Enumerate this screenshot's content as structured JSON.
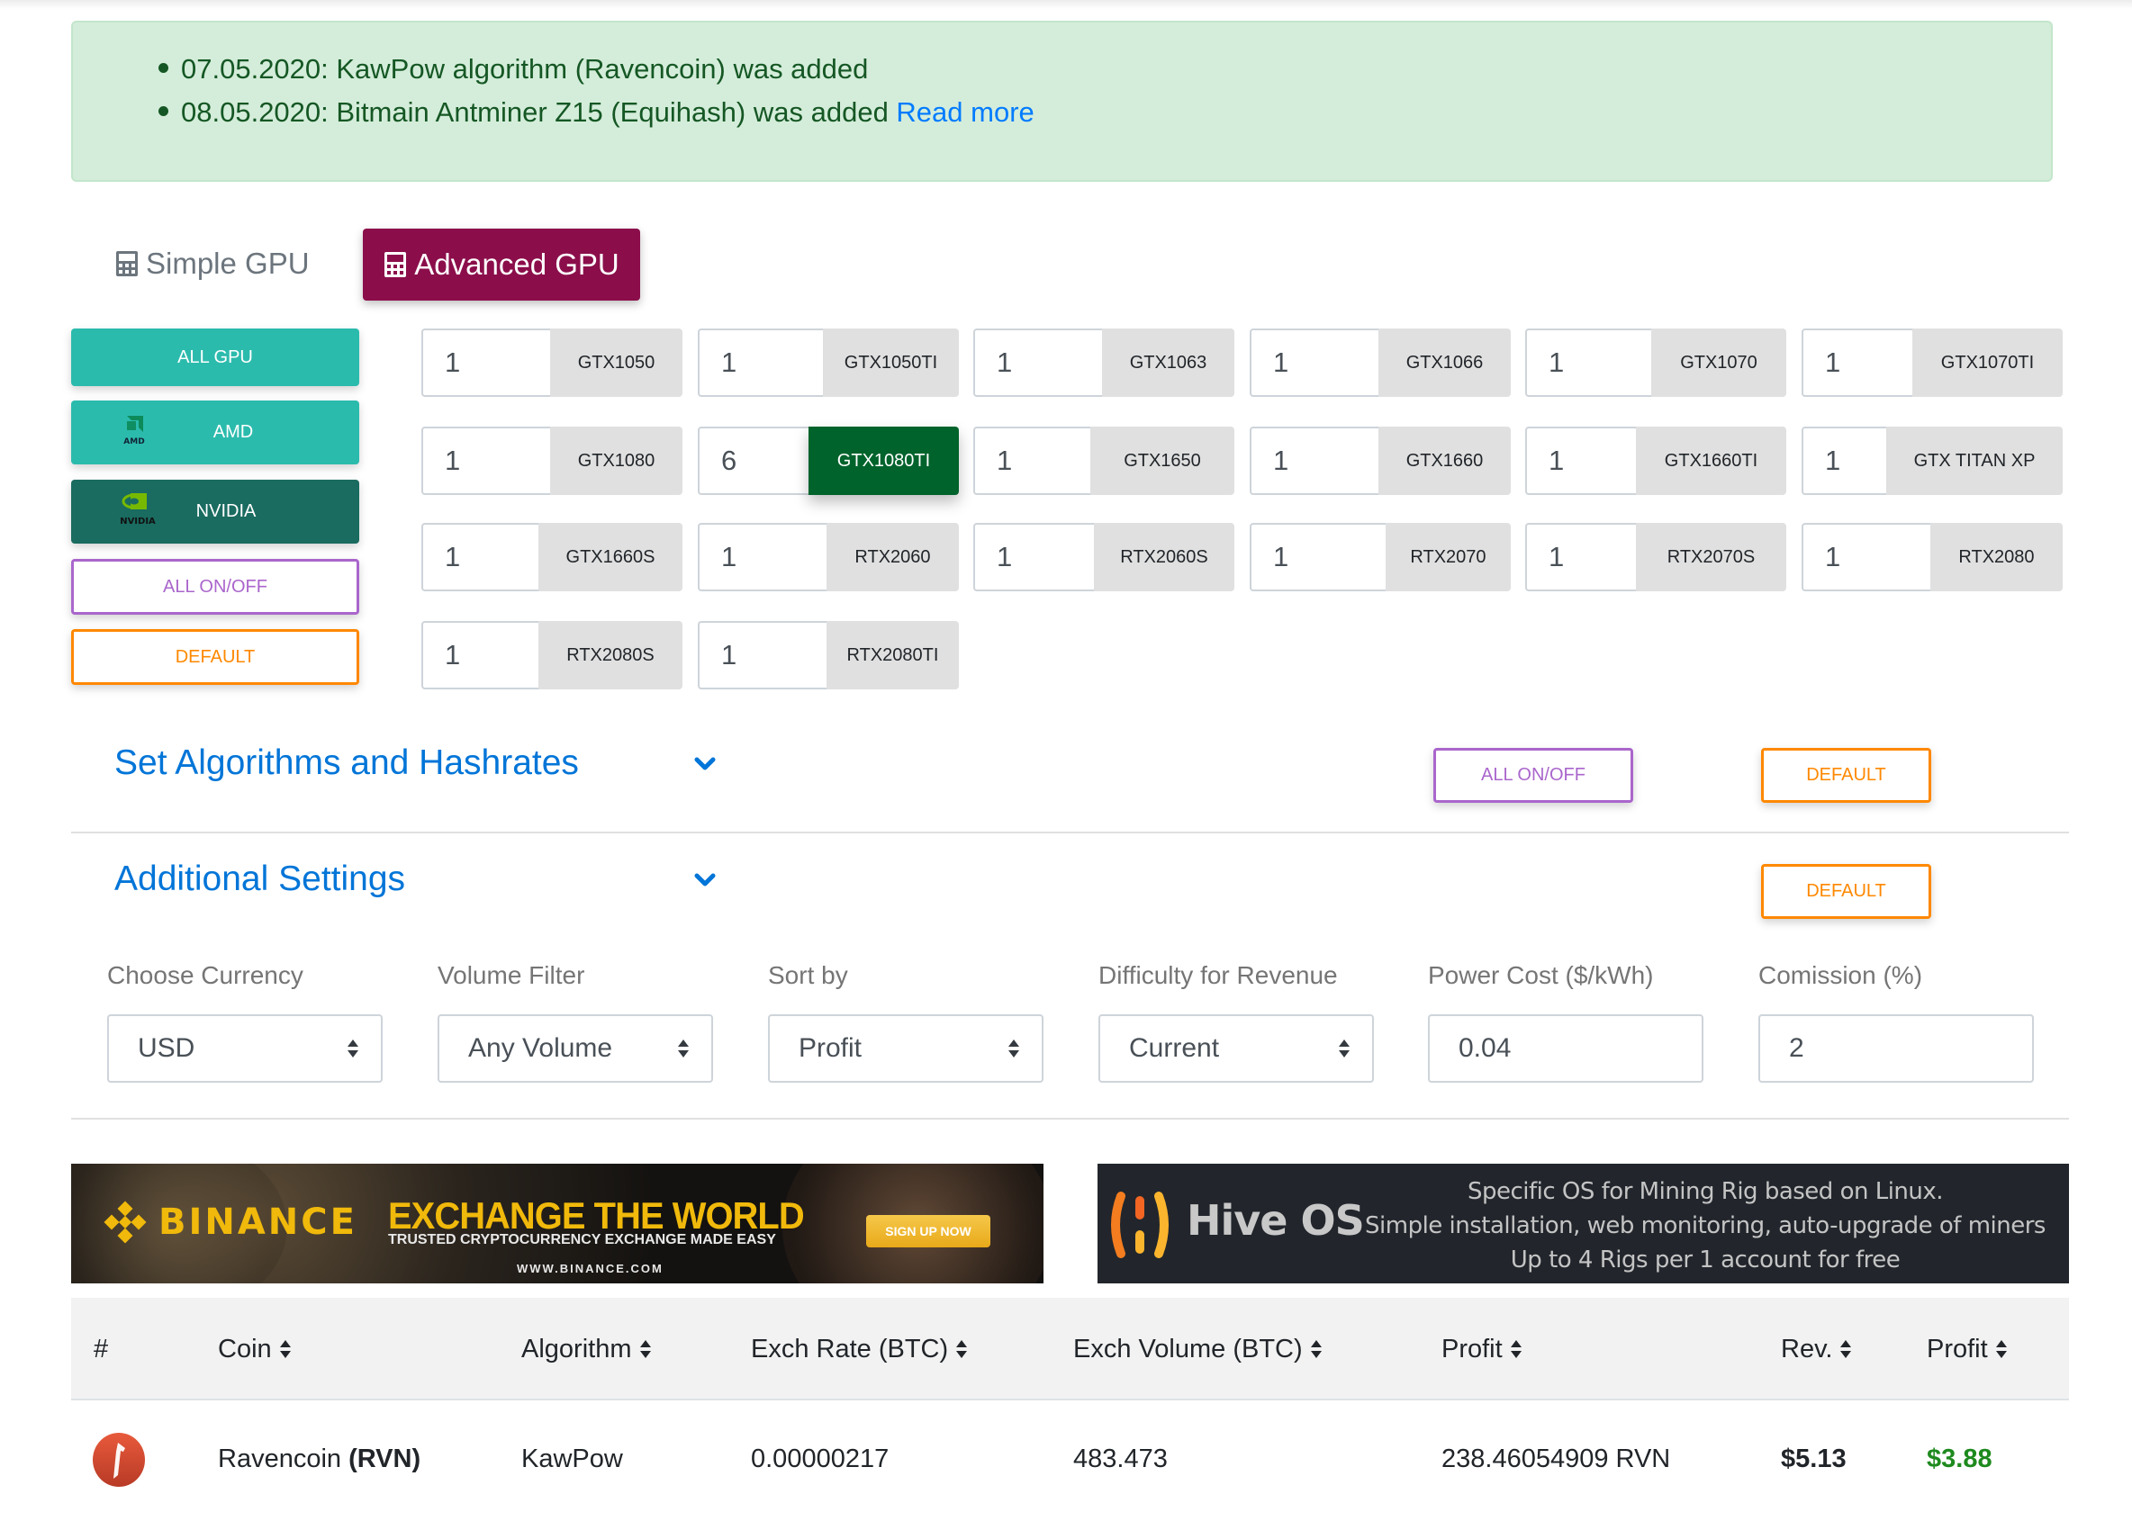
{
  "announcements": {
    "items": [
      {
        "text": "07.05.2020: KawPow algorithm (Ravencoin) was added",
        "link": ""
      },
      {
        "text": "08.05.2020: Bitmain Antminer Z15 (Equihash) was added ",
        "link": "Read more"
      }
    ]
  },
  "tabs": {
    "simple": {
      "label": "Simple GPU",
      "icon": "calculator-icon",
      "active": false
    },
    "advanced": {
      "label": "Advanced GPU",
      "icon": "calculator-icon",
      "active": true
    }
  },
  "filters": {
    "all_gpu": "ALL GPU",
    "amd": "AMD",
    "amd_logo": "AMD",
    "nvidia": "NVIDIA",
    "nvidia_logo": "NVIDIA",
    "all_on_off": "ALL ON/OFF",
    "default": "DEFAULT"
  },
  "gpus": [
    {
      "name": "GTX1050",
      "qty": "1",
      "active": false
    },
    {
      "name": "GTX1050TI",
      "qty": "1",
      "active": false
    },
    {
      "name": "GTX1063",
      "qty": "1",
      "active": false
    },
    {
      "name": "GTX1066",
      "qty": "1",
      "active": false
    },
    {
      "name": "GTX1070",
      "qty": "1",
      "active": false
    },
    {
      "name": "GTX1070TI",
      "qty": "1",
      "active": false
    },
    {
      "name": "GTX1080",
      "qty": "1",
      "active": false
    },
    {
      "name": "GTX1080TI",
      "qty": "6",
      "active": true
    },
    {
      "name": "GTX1650",
      "qty": "1",
      "active": false
    },
    {
      "name": "GTX1660",
      "qty": "1",
      "active": false
    },
    {
      "name": "GTX1660TI",
      "qty": "1",
      "active": false
    },
    {
      "name": "GTX TITAN XP",
      "qty": "1",
      "active": false
    },
    {
      "name": "GTX1660S",
      "qty": "1",
      "active": false
    },
    {
      "name": "RTX2060",
      "qty": "1",
      "active": false
    },
    {
      "name": "RTX2060S",
      "qty": "1",
      "active": false
    },
    {
      "name": "RTX2070",
      "qty": "1",
      "active": false
    },
    {
      "name": "RTX2070S",
      "qty": "1",
      "active": false
    },
    {
      "name": "RTX2080",
      "qty": "1",
      "active": false
    },
    {
      "name": "RTX2080S",
      "qty": "1",
      "active": false
    },
    {
      "name": "RTX2080TI",
      "qty": "1",
      "active": false
    }
  ],
  "sections": {
    "algorithms": {
      "title": "Set Algorithms and Hashrates",
      "all_on_off": "ALL ON/OFF",
      "default": "DEFAULT"
    },
    "additional": {
      "title": "Additional Settings",
      "default": "DEFAULT"
    }
  },
  "settings": [
    {
      "label": "Choose Currency",
      "value": "USD",
      "type": "select"
    },
    {
      "label": "Volume Filter",
      "value": "Any Volume",
      "type": "select"
    },
    {
      "label": "Sort by",
      "value": "Profit",
      "type": "select"
    },
    {
      "label": "Difficulty for Revenue",
      "value": "Current",
      "type": "select"
    },
    {
      "label": "Power Cost ($/kWh)",
      "value": "0.04",
      "type": "input"
    },
    {
      "label": "Comission (%)",
      "value": "2",
      "type": "input"
    }
  ],
  "banners": {
    "binance": {
      "brand": "BINANCE",
      "headline": "EXCHANGE THE WORLD",
      "subline": "TRUSTED CRYPTOCURRENCY EXCHANGE MADE EASY",
      "url": "WWW.BINANCE.COM",
      "cta": "SIGN UP NOW"
    },
    "hive": {
      "brand": "Hive OS",
      "lines": [
        "Specific OS for Mining Rig based on Linux.",
        "Simple installation, web monitoring, auto-upgrade of miners",
        "Up to 4 Rigs per 1 account for free"
      ]
    }
  },
  "table": {
    "columns": [
      "#",
      "Coin",
      "Algorithm",
      "Exch Rate (BTC)",
      "Exch Volume (BTC)",
      "Profit",
      "Rev.",
      "Profit"
    ],
    "sortable": [
      false,
      true,
      true,
      true,
      true,
      true,
      true,
      true
    ],
    "rows": [
      {
        "icon": "ravencoin-icon",
        "coin_name": "Ravencoin ",
        "coin_ticker": "(RVN)",
        "algorithm": "KawPow",
        "exch_rate": "0.00000217",
        "exch_volume": "483.473",
        "profit_coins": "238.46054909 RVN",
        "revenue": "$5.13",
        "profit_usd": "$3.88"
      }
    ]
  },
  "colors": {
    "accent_tab": "#8b0e4b",
    "teal": "#2bbbad",
    "nvidia_dark": "#1a6b60",
    "active_gpu": "#00632b",
    "purple": "#aa66cc",
    "orange": "#ff8800",
    "link_blue": "#0275d8",
    "alert_bg": "#d4edda",
    "profit_green": "#1e8a1e"
  }
}
